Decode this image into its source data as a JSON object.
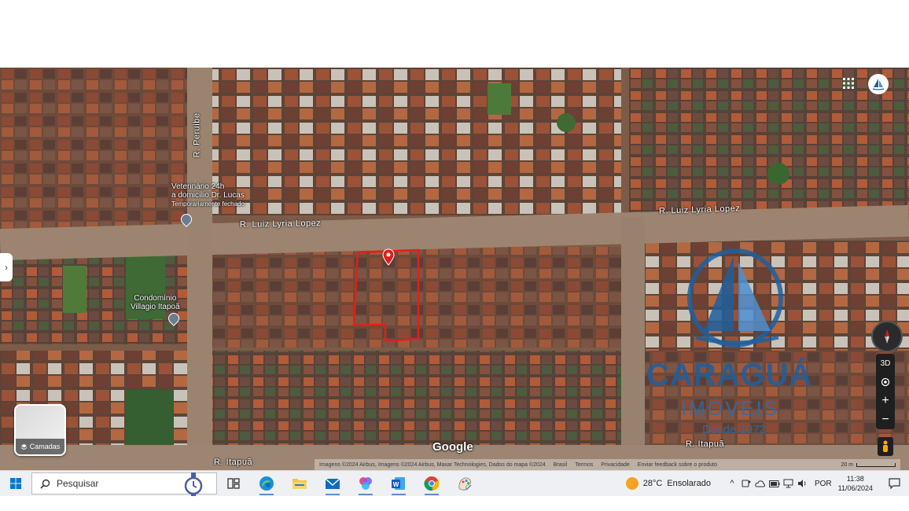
{
  "map": {
    "streets": {
      "main_left": "R. Luiz Lyria Lopez",
      "main_right": "R. Luiz Lyria Lopez",
      "vertical": "R. Peruibe",
      "bottom_left": "R. Itapuã",
      "bottom_right": "R. Itapuã"
    },
    "pois": {
      "vet_line1": "Veterinário 24h",
      "vet_line2": "a domicílio Dr. Lucas",
      "vet_line3": "Temporariamente fechado",
      "condo_line1": "Condomínio",
      "condo_line2": "Villagio Itapoã"
    },
    "google_logo": "Google",
    "attribution": {
      "imagery": "Imagens ©2024 Airbus, Imagens ©2024 Airbus, Maxar Technologies, Dados do mapa ©2024",
      "country": "Brasil",
      "terms": "Termos",
      "privacy": "Privacidade",
      "feedback": "Enviar feedback sobre o produto",
      "scale": "20 m"
    },
    "layers_label": "Camadas",
    "controls": {
      "three_d": "3D",
      "zoom_in": "+",
      "zoom_out": "−"
    },
    "watermark": {
      "brand": "CARAGUÁ",
      "sub": "IMÓVEIS",
      "since": "Desde 1972"
    },
    "highlight_color": "#e0201b"
  },
  "taskbar": {
    "search_placeholder": "Pesquisar",
    "weather_temp": "28°C",
    "weather_desc": "Ensolarado",
    "language": "POR",
    "time": "11:38",
    "date": "11/06/2024",
    "apps": [
      "task-view-icon",
      "edge-icon",
      "file-explorer-icon",
      "mail-icon",
      "photos-icon",
      "word-icon",
      "chrome-icon",
      "paint-icon"
    ]
  }
}
